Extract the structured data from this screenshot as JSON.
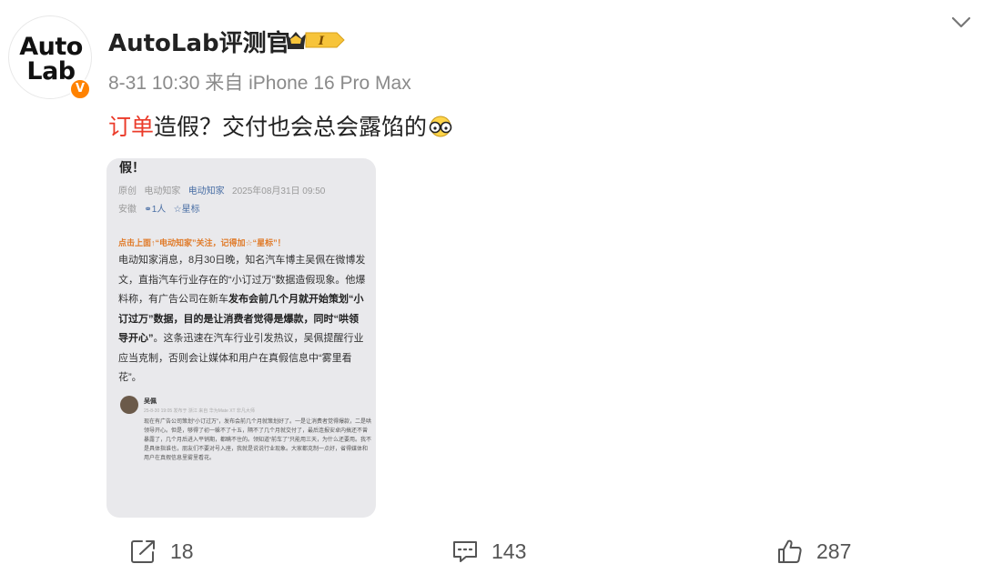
{
  "author": {
    "name": "AutoLab评测官",
    "avatar_logo": [
      "Auto",
      "Lab"
    ],
    "verified_badge": "V",
    "vip_level": "I"
  },
  "meta": {
    "time": "8-31 10:30",
    "source": "来自 iPhone 16 Pro Max"
  },
  "post": {
    "highlight": "订单",
    "text": "造假？交付也会总会露馅的"
  },
  "screenshot": {
    "title": "假！",
    "meta_line1_tag": "原创",
    "meta_line1_author": "电动知家",
    "meta_line1_account": "电动知家",
    "meta_line1_time": "2025年08月31日 09:50",
    "meta_line2_region": "安徽",
    "meta_line2_listen": "1人",
    "meta_line2_star": "星标",
    "cta": "点击上面↑“电动知家”关注，记得加☆“星标”！",
    "body_part1": "电动知家消息，8月30日晚，知名汽车博主吴佩在微博发文，直指汽车行业存在的“小订过万”数据造假现象。他爆料称，有广告公司在新车",
    "body_bold1": "发布会前几个月就开始策划“小订过万”数据，目的是让消费者觉得是爆款，同时“哄领导开心”",
    "body_part2": "。这条迅速在汽车行业引发热议，吴佩提醒行业应当克制，否则会让媒体和用户在真假信息中“雾里看花”。",
    "quote_name": "吴佩",
    "quote_meta": "25-8-30 19:05 发布于 浙江 来自 华为Mate XT 非凡大师",
    "quote_text": "现在有广告公司策划“小订过万”，发布会前几个月就策划好了。一是让消费者觉得爆款，二是哄领导开心。但是，够得了初一躲不了十五，隔不了几个月就交付了，最后连报安卓内搞还不曾暴露了，几个月后进入平销期，都瞒不住的。领知道“前车了”只能用三天，为什么还要用。我不是具体指谁也，朋友们不要对号入座，我就是说说行业现象。大家都克制一点好，省得媒体和用户在真假信息里雾里看花。"
  },
  "actions": {
    "share_count": "18",
    "comment_count": "143",
    "like_count": "287"
  },
  "colors": {
    "highlight": "#eb3b2a",
    "verified": "#ff8200",
    "vip_gold": "#f7c43a",
    "meta_gray": "#8a8a8a"
  },
  "icons": [
    "share-icon",
    "comment-icon",
    "like-icon",
    "chevron-down-icon",
    "emoji-glasses-icon",
    "crown-icon"
  ]
}
